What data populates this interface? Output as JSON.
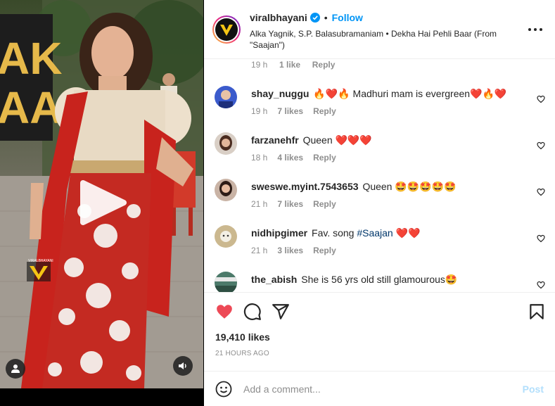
{
  "post": {
    "username": "viralbhayani",
    "follow_label": "Follow",
    "separator": "•",
    "audio": "Alka Yagnik, S.P. Balasubramaniam • Dekha Hai Pehli Baar (From \"Saajan\")"
  },
  "media": {
    "sign_text": "AK\nAA",
    "watermark": "VIRALBHAYANI"
  },
  "comments": {
    "top_meta": {
      "time": "19 h",
      "likes": "1 like",
      "reply": "Reply"
    },
    "items": [
      {
        "user": "shay_nuggu",
        "text": "🔥❤️🔥 Madhuri mam is evergreen❤️🔥❤️",
        "time": "19 h",
        "likes": "7 likes",
        "reply": "Reply",
        "avatar_color": "#3b5bcc"
      },
      {
        "user": "farzanehfr",
        "text": "Queen ❤️❤️❤️",
        "time": "18 h",
        "likes": "4 likes",
        "reply": "Reply",
        "avatar_color": "#7a5a48"
      },
      {
        "user": "sweswe.myint.7543653",
        "text": "Queen 🤩🤩🤩🤩🤩",
        "time": "21 h",
        "likes": "7 likes",
        "reply": "Reply",
        "avatar_color": "#6b4a3a"
      },
      {
        "user": "nidhipgimer",
        "text_before": "Fav. song ",
        "hashtag": "#Saajan",
        "text_after": " ❤️❤️",
        "time": "21 h",
        "likes": "3 likes",
        "reply": "Reply",
        "avatar_color": "#c9b48a"
      },
      {
        "user": "the_abish",
        "text": "She is 56 yrs old still glamourous🤩",
        "avatar_color": "#4c7a6a"
      }
    ]
  },
  "actions": {
    "likes": "19,410 likes",
    "time_ago": "21 HOURS AGO",
    "like_color": "#ed4956"
  },
  "add_comment": {
    "placeholder": "Add a comment...",
    "post_label": "Post"
  },
  "colors": {
    "accent": "#0095f6",
    "text": "#262626",
    "muted": "#8e8e8e"
  }
}
